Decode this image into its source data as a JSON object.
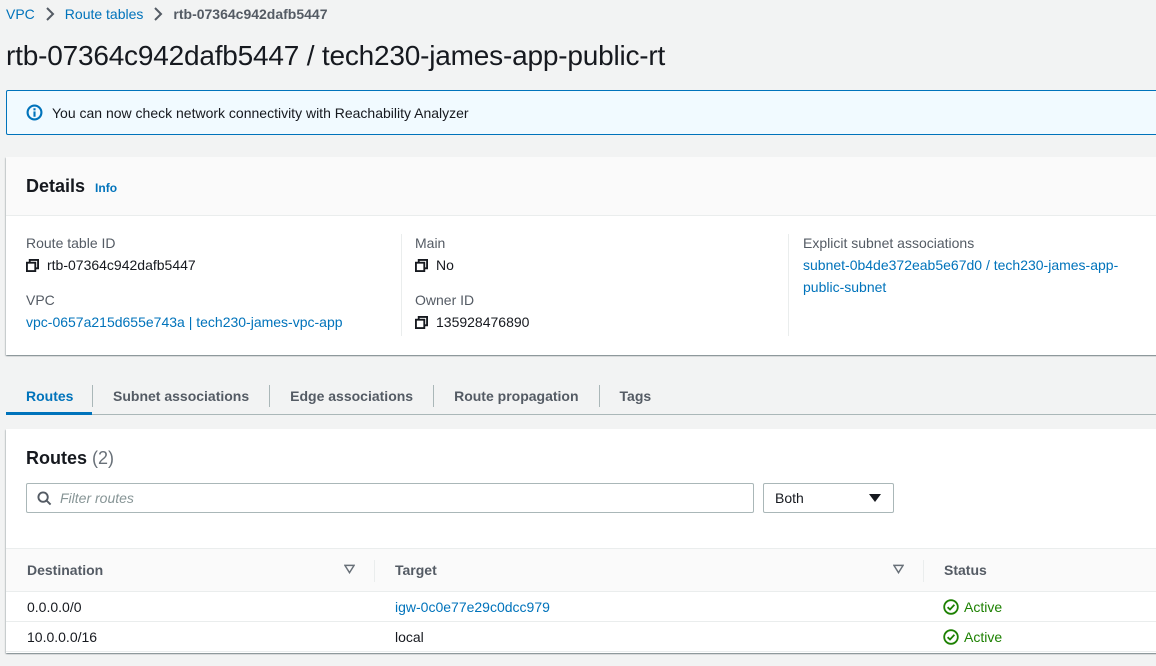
{
  "breadcrumb": {
    "items": [
      "VPC",
      "Route tables"
    ],
    "current": "rtb-07364c942dafb5447"
  },
  "page": {
    "title": "rtb-07364c942dafb5447 / tech230-james-app-public-rt"
  },
  "flash": {
    "message": "You can now check network connectivity with Reachability Analyzer",
    "icon": "info-circle-icon"
  },
  "details": {
    "title": "Details",
    "info_label": "Info",
    "route_table_id": {
      "label": "Route table ID",
      "value": "rtb-07364c942dafb5447"
    },
    "vpc": {
      "label": "VPC",
      "value": "vpc-0657a215d655e743a | tech230-james-vpc-app"
    },
    "main": {
      "label": "Main",
      "value": "No"
    },
    "owner_id": {
      "label": "Owner ID",
      "value": "135928476890"
    },
    "explicit_subnet": {
      "label": "Explicit subnet associations",
      "value_line1": "subnet-0b4de372eab5e67d0 / tech230-james-app-",
      "value_line2": "public-subnet"
    }
  },
  "tabs": [
    {
      "label": "Routes",
      "active": true
    },
    {
      "label": "Subnet associations",
      "active": false
    },
    {
      "label": "Edge associations",
      "active": false
    },
    {
      "label": "Route propagation",
      "active": false
    },
    {
      "label": "Tags",
      "active": false
    }
  ],
  "routes": {
    "title": "Routes",
    "count": "(2)",
    "filter_placeholder": "Filter routes",
    "select_value": "Both",
    "columns": {
      "destination": "Destination",
      "target": "Target",
      "status": "Status"
    },
    "rows": [
      {
        "destination": "0.0.0.0/0",
        "target": "igw-0c0e77e29c0dcc979",
        "target_is_link": true,
        "status": "Active"
      },
      {
        "destination": "10.0.0.0/16",
        "target": "local",
        "target_is_link": false,
        "status": "Active"
      }
    ]
  },
  "colors": {
    "link": "#0073bb",
    "success": "#1d8102",
    "info_bg": "#f1faff"
  }
}
